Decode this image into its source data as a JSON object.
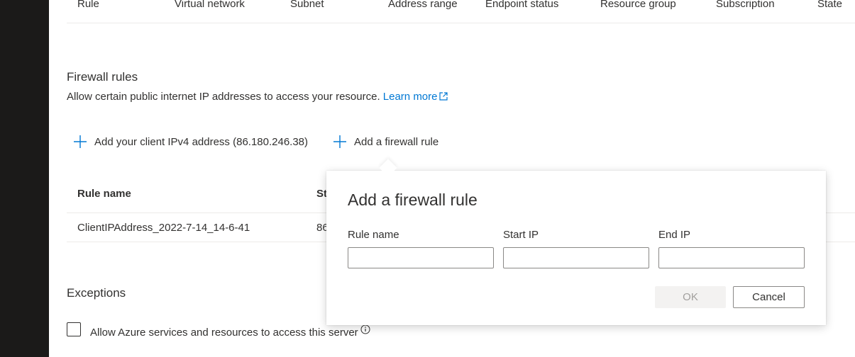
{
  "vnet_table": {
    "columns": [
      "Rule",
      "Virtual network",
      "Subnet",
      "Address range",
      "Endpoint status",
      "Resource group",
      "Subscription",
      "State"
    ]
  },
  "firewall": {
    "title": "Firewall rules",
    "description": "Allow certain public internet IP addresses to access your resource.",
    "learn_more": "Learn more",
    "add_client_ip": "Add your client IPv4 address (86.180.246.38)",
    "add_rule": "Add a firewall rule",
    "table": {
      "headers": [
        "Rule name",
        "St"
      ],
      "rows": [
        {
          "rule_name": "ClientIPAddress_2022-7-14_14-6-41",
          "start_ip": "86"
        }
      ]
    }
  },
  "exceptions": {
    "title": "Exceptions",
    "allow_azure_label": "Allow Azure services and resources to access this server",
    "allow_azure_checked": false
  },
  "callout": {
    "title": "Add a firewall rule",
    "rule_name_label": "Rule name",
    "start_ip_label": "Start IP",
    "end_ip_label": "End IP",
    "rule_name_value": "",
    "start_ip_value": "",
    "end_ip_value": "",
    "ok_label": "OK",
    "cancel_label": "Cancel",
    "ok_disabled": true
  },
  "colors": {
    "accent": "#0078d4",
    "sidebar": "#1b1a19",
    "text": "#323130",
    "disabled_text": "#a19f9d"
  }
}
